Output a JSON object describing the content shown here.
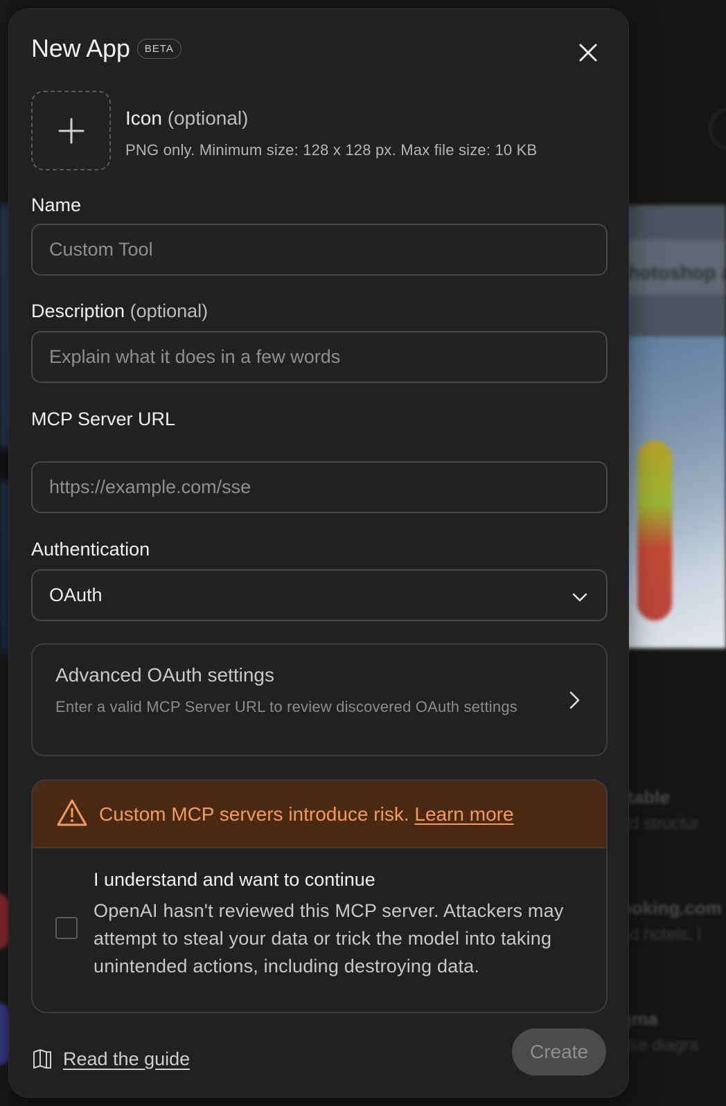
{
  "background": {
    "card_text": "hotoshop a",
    "items": [
      {
        "title": "rtable",
        "sub": "dd structur"
      },
      {
        "title": "ooking.com",
        "sub": "nd hotels, l"
      },
      {
        "title": "gma",
        "sub": "ake diagra"
      }
    ]
  },
  "modal": {
    "title": "New App",
    "badge": "BETA",
    "close_icon": "close-icon"
  },
  "icon_field": {
    "label": "Icon",
    "optional": "(optional)",
    "hint": "PNG only. Minimum size: 128 x 128 px. Max file size: 10 KB",
    "upload_icon": "plus-icon"
  },
  "name_field": {
    "label": "Name",
    "placeholder": "Custom Tool"
  },
  "description_field": {
    "label": "Description",
    "optional": "(optional)",
    "placeholder": "Explain what it does in a few words"
  },
  "server_field": {
    "label": "MCP Server URL",
    "placeholder": "https://example.com/sse"
  },
  "auth_field": {
    "label": "Authentication",
    "value": "OAuth",
    "options": [
      "OAuth"
    ]
  },
  "advanced": {
    "title": "Advanced OAuth settings",
    "description": "Enter a valid MCP Server URL to review discovered OAuth settings"
  },
  "warning": {
    "text": "Custom MCP servers introduce risk.",
    "link": "Learn more",
    "color": "#f59a5a",
    "background": "#4a2a12",
    "agree_title": "I understand and want to continue",
    "agree_desc": "OpenAI hasn't reviewed this MCP server. Attackers may attempt to steal your data or trick the model into taking unintended actions, including destroying data.",
    "checked": false
  },
  "footer": {
    "guide_label": "Read the guide",
    "create_label": "Create"
  }
}
